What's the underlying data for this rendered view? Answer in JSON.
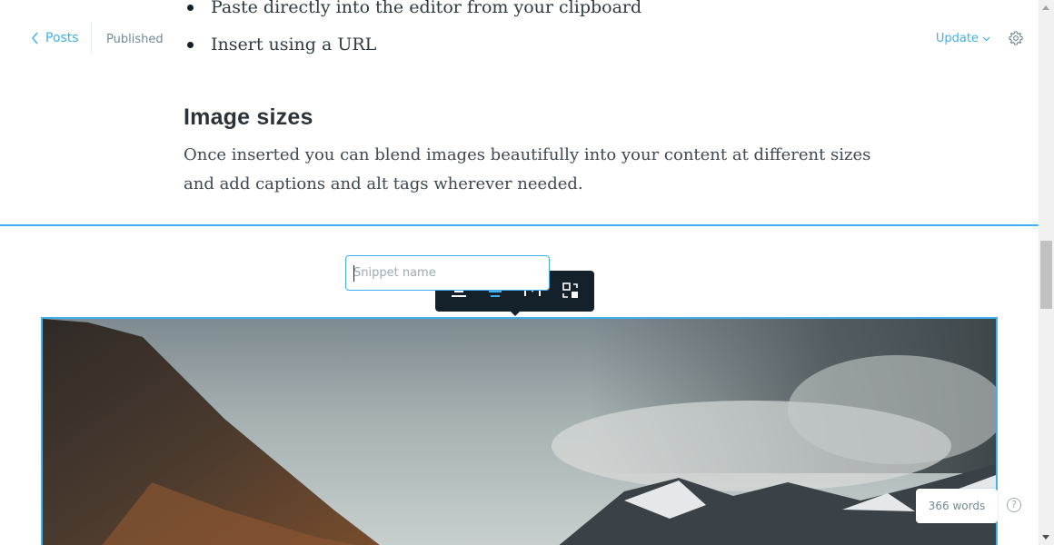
{
  "header": {
    "back_label": "Posts",
    "status": "Published",
    "update_label": "Update"
  },
  "content": {
    "list_items": [
      "Paste directly into the editor from your clipboard",
      "Insert using a URL"
    ],
    "heading": "Image sizes",
    "paragraph": "Once inserted you can blend images beautifully into your content at different sizes and add captions and alt tags wherever needed."
  },
  "snippet": {
    "placeholder": "Snippet name",
    "value": ""
  },
  "image_toolbar": {
    "icons": [
      "image-regular-width-icon",
      "image-wide-width-icon",
      "image-full-width-icon",
      "replace-image-icon"
    ]
  },
  "footer": {
    "word_count": "366 words",
    "help": "?"
  },
  "colors": {
    "accent": "#3eb0ef",
    "dark": "#15212a",
    "muted": "#738a94"
  }
}
